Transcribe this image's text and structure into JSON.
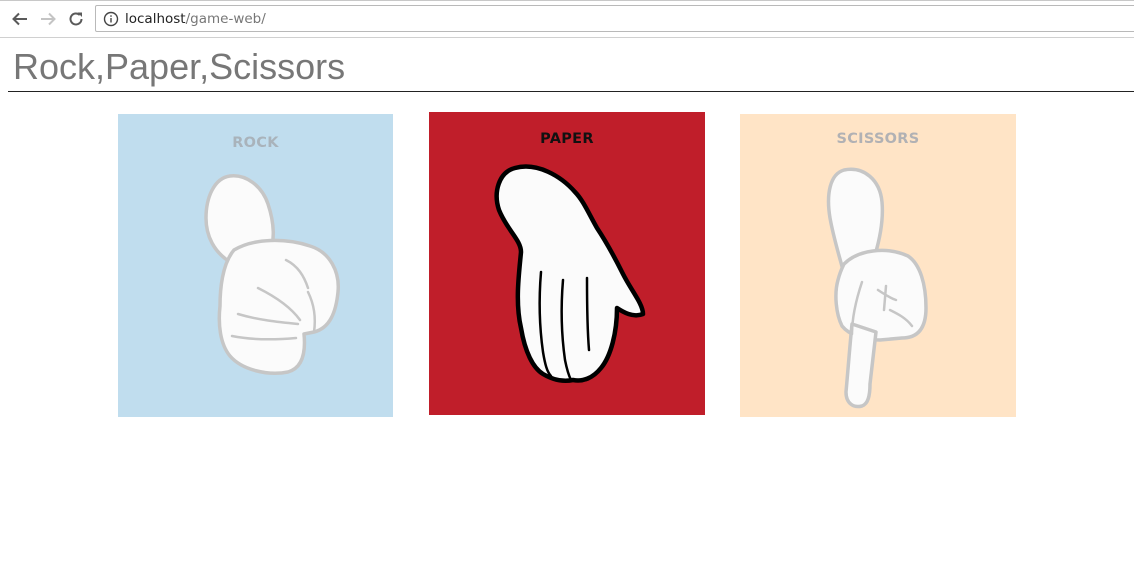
{
  "browser": {
    "url_host": "localhost",
    "url_path": "/game-web/",
    "back_icon": "back-arrow-icon",
    "forward_icon": "forward-arrow-icon",
    "reload_icon": "reload-icon",
    "info_icon": "info-icon"
  },
  "page": {
    "title": "Rock,Paper,Scissors"
  },
  "choices": [
    {
      "label": "ROCK",
      "bg_color": "#c0ddee",
      "label_color": "#a9b3bb",
      "selected": false,
      "icon": "rock-hand-icon"
    },
    {
      "label": "PAPER",
      "bg_color": "#c01e2a",
      "label_color": "#111111",
      "selected": true,
      "icon": "paper-hand-icon"
    },
    {
      "label": "SCISSORS",
      "bg_color": "#ffe4c6",
      "label_color": "#b1b1b4",
      "selected": false,
      "icon": "scissors-hand-icon"
    }
  ]
}
